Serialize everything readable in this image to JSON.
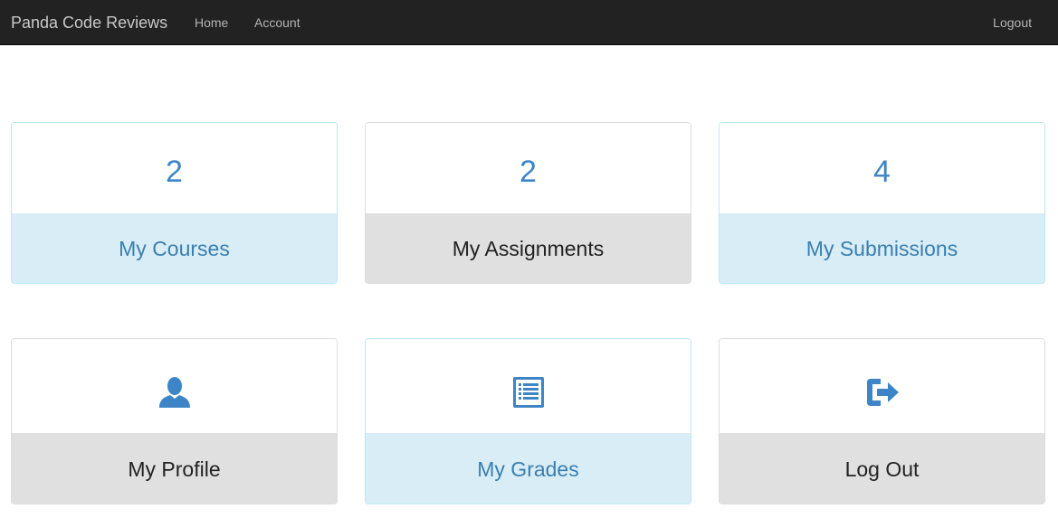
{
  "navbar": {
    "brand": "Panda Code Reviews",
    "links": [
      {
        "label": "Home"
      },
      {
        "label": "Account"
      }
    ],
    "logout_label": "Logout"
  },
  "dashboard": {
    "courses": {
      "count": "2",
      "label": "My Courses"
    },
    "assignments": {
      "count": "2",
      "label": "My Assignments"
    },
    "submissions": {
      "count": "4",
      "label": "My Submissions"
    },
    "profile": {
      "icon": "user-icon",
      "label": "My Profile"
    },
    "grades": {
      "icon": "list-alt-icon",
      "label": "My Grades"
    },
    "logout": {
      "icon": "log-out-icon",
      "label": "Log Out"
    }
  },
  "colors": {
    "navbar_bg": "#222222",
    "accent_blue": "#337ab7",
    "info_bg": "#d9edf7",
    "info_text": "#31708f",
    "plain_bg": "#e0e0e0"
  }
}
